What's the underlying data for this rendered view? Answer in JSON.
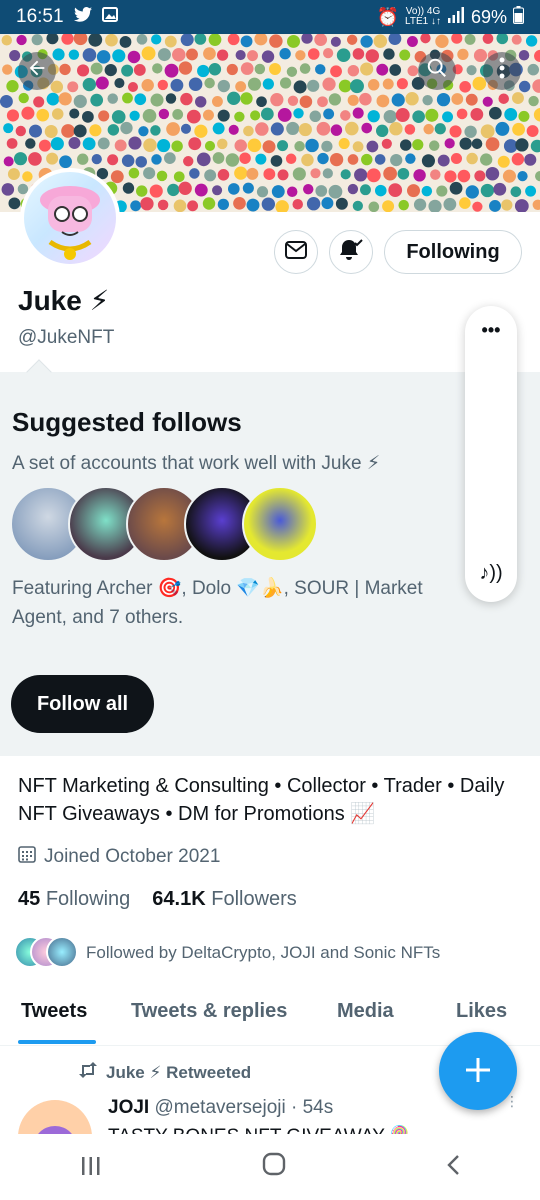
{
  "status_bar": {
    "time": "16:51",
    "network_top": "Vo)) 4G",
    "network_bottom": "LTE1 ↓↑",
    "battery": "69%"
  },
  "profile": {
    "name": "Juke ⚡",
    "handle": "@JukeNFT",
    "following_button": "Following",
    "bio": "NFT Marketing & Consulting • Collector • Trader • Daily NFT Giveaways • DM for Promotions 📈",
    "joined": "Joined October 2021",
    "following_count": "45",
    "following_label": "Following",
    "followers_count": "64.1K",
    "followers_label": "Followers",
    "followed_by": "Followed by DeltaCrypto, JOJI and Sonic NFTs"
  },
  "suggested": {
    "title": "Suggested follows",
    "description": "A set of accounts that work well with Juke ⚡",
    "featuring": "Featuring Archer 🎯, Dolo 💎🍌, SOUR | Market Agent, and 7 others.",
    "follow_all": "Follow all"
  },
  "tabs": [
    "Tweets",
    "Tweets & replies",
    "Media",
    "Likes"
  ],
  "active_tab": "Tweets",
  "tweet": {
    "retweet_label": "Juke ⚡ Retweeted",
    "author": "JOJI",
    "handle_time": "@metaversejoji · 54s",
    "text": "TASTY BONES NFT GIVEAWAY 🍭"
  },
  "side_panel": {
    "more": "•••",
    "sound": "♪))"
  },
  "colors": {
    "accent": "#1d9bf0",
    "status_bar": "#0f4c75",
    "dark_button": "#0f1419"
  }
}
